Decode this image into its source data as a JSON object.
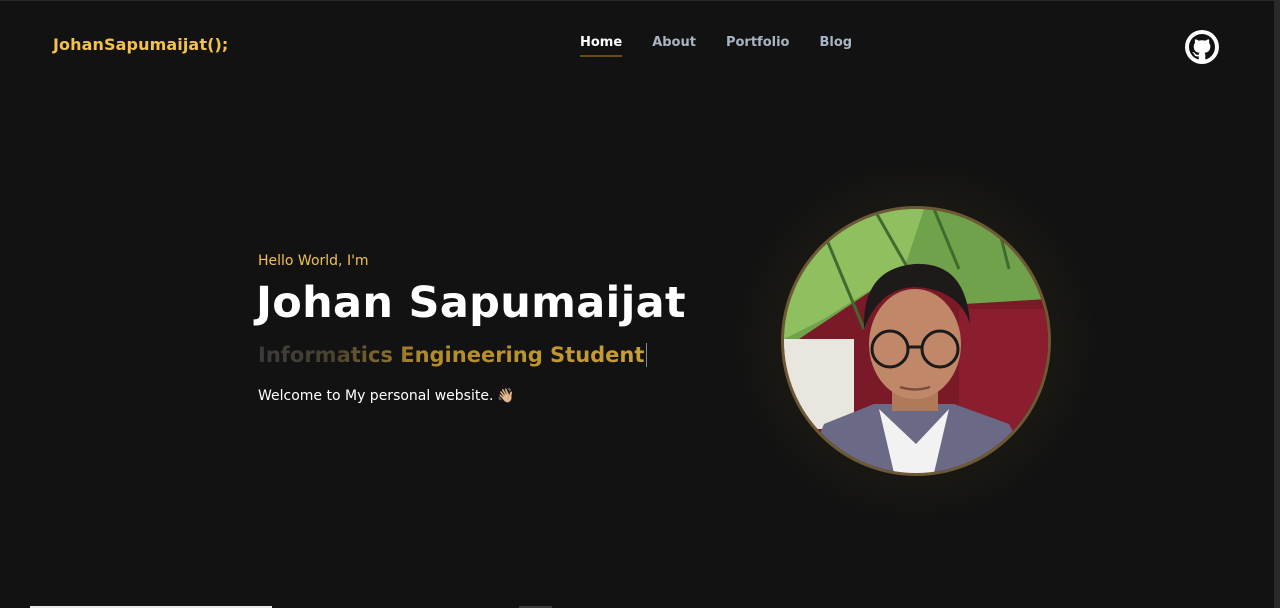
{
  "header": {
    "logo": "JohanSapumaijat();",
    "nav": [
      {
        "label": "Home",
        "active": true
      },
      {
        "label": "About",
        "active": false
      },
      {
        "label": "Portfolio",
        "active": false
      },
      {
        "label": "Blog",
        "active": false
      }
    ],
    "github_icon": "github-icon"
  },
  "hero": {
    "greeting": "Hello World, I'm",
    "name": "Johan Sapumaijat",
    "role": "Informatics Engineering Student",
    "welcome": "Welcome to My personal website.",
    "wave_emoji": "👋🏼"
  },
  "colors": {
    "accent": "#f2c24a",
    "background": "#121212",
    "nav_text": "#a9b4c4"
  }
}
